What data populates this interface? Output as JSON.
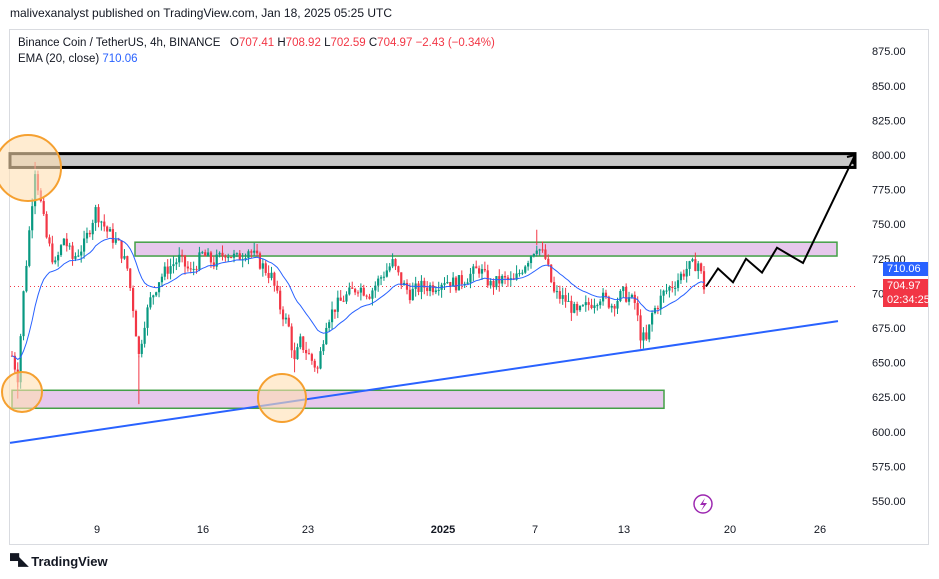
{
  "header": {
    "published_line": "malivexanalyst published on TradingView.com, Jan 18, 2025 05:25 UTC"
  },
  "legend": {
    "symbol": "Binance Coin / TetherUS, 4h, BINANCE",
    "o_label": "O",
    "o_value": "707.41",
    "h_label": "H",
    "h_value": "708.92",
    "l_label": "L",
    "l_value": "702.59",
    "c_label": "C",
    "c_value": "704.97",
    "change": "−2.43 (−0.34%)",
    "ema_label": "EMA (20, close)",
    "ema_value": "710.06"
  },
  "price_tags": {
    "ema": "710.06",
    "last": "704.97",
    "countdown": "02:34:25"
  },
  "footer": {
    "brand": "TradingView"
  },
  "colors": {
    "up": "#089981",
    "down": "#f23645",
    "ema": "#2962ff",
    "zone_fill": "#e6c8ec",
    "zone_border": "#43a047",
    "circle_fill": "#ffe0b2",
    "circle_border": "#f5a030",
    "trendline": "#2962ff",
    "projection": "#000000"
  },
  "chart_data": {
    "type": "candlestick",
    "timeframe": "4h",
    "y_axis": {
      "ticks": [
        "875.00",
        "850.00",
        "825.00",
        "800.00",
        "775.00",
        "750.00",
        "725.00",
        "700.00",
        "675.00",
        "650.00",
        "625.00",
        "600.00",
        "575.00",
        "550.00"
      ],
      "range": [
        538,
        888
      ]
    },
    "x_axis": {
      "ticks": [
        "9",
        "16",
        "23",
        "2025",
        "7",
        "13",
        "20",
        "26"
      ]
    },
    "last_price": 704.97,
    "ema_last": 710.06,
    "price_path": [
      {
        "t": 0,
        "p": 655
      },
      {
        "t": 2,
        "p": 640
      },
      {
        "t": 4,
        "p": 700
      },
      {
        "t": 6,
        "p": 745
      },
      {
        "t": 8,
        "p": 790
      },
      {
        "t": 10,
        "p": 765
      },
      {
        "t": 12,
        "p": 740
      },
      {
        "t": 15,
        "p": 720
      },
      {
        "t": 18,
        "p": 740
      },
      {
        "t": 21,
        "p": 725
      },
      {
        "t": 25,
        "p": 735
      },
      {
        "t": 29,
        "p": 760
      },
      {
        "t": 33,
        "p": 745
      },
      {
        "t": 37,
        "p": 735
      },
      {
        "t": 40,
        "p": 718
      },
      {
        "t": 42,
        "p": 690
      },
      {
        "t": 44,
        "p": 655
      },
      {
        "t": 46,
        "p": 680
      },
      {
        "t": 48,
        "p": 695
      },
      {
        "t": 51,
        "p": 710
      },
      {
        "t": 54,
        "p": 718
      },
      {
        "t": 58,
        "p": 725
      },
      {
        "t": 62,
        "p": 715
      },
      {
        "t": 66,
        "p": 728
      },
      {
        "t": 70,
        "p": 722
      },
      {
        "t": 74,
        "p": 730
      },
      {
        "t": 78,
        "p": 725
      },
      {
        "t": 82,
        "p": 732
      },
      {
        "t": 86,
        "p": 722
      },
      {
        "t": 90,
        "p": 712
      },
      {
        "t": 93,
        "p": 690
      },
      {
        "t": 96,
        "p": 675
      },
      {
        "t": 98,
        "p": 650
      },
      {
        "t": 100,
        "p": 665
      },
      {
        "t": 103,
        "p": 655
      },
      {
        "t": 106,
        "p": 645
      },
      {
        "t": 109,
        "p": 680
      },
      {
        "t": 112,
        "p": 690
      },
      {
        "t": 116,
        "p": 698
      },
      {
        "t": 120,
        "p": 705
      },
      {
        "t": 124,
        "p": 700
      },
      {
        "t": 128,
        "p": 712
      },
      {
        "t": 132,
        "p": 722
      },
      {
        "t": 135,
        "p": 708
      },
      {
        "t": 138,
        "p": 700
      },
      {
        "t": 142,
        "p": 705
      },
      {
        "t": 146,
        "p": 705
      },
      {
        "t": 150,
        "p": 710
      },
      {
        "t": 154,
        "p": 707
      },
      {
        "t": 158,
        "p": 712
      },
      {
        "t": 162,
        "p": 718
      },
      {
        "t": 166,
        "p": 706
      },
      {
        "t": 170,
        "p": 710
      },
      {
        "t": 174,
        "p": 708
      },
      {
        "t": 178,
        "p": 722
      },
      {
        "t": 182,
        "p": 735
      },
      {
        "t": 185,
        "p": 725
      },
      {
        "t": 188,
        "p": 700
      },
      {
        "t": 192,
        "p": 695
      },
      {
        "t": 196,
        "p": 685
      },
      {
        "t": 200,
        "p": 692
      },
      {
        "t": 204,
        "p": 698
      },
      {
        "t": 208,
        "p": 692
      },
      {
        "t": 212,
        "p": 700
      },
      {
        "t": 216,
        "p": 693
      },
      {
        "t": 218,
        "p": 670
      },
      {
        "t": 220,
        "p": 665
      },
      {
        "t": 222,
        "p": 685
      },
      {
        "t": 226,
        "p": 700
      },
      {
        "t": 230,
        "p": 708
      },
      {
        "t": 234,
        "p": 718
      },
      {
        "t": 238,
        "p": 722
      },
      {
        "t": 240,
        "p": 705
      }
    ],
    "annotations": {
      "resistance_zone_top": {
        "low": 791,
        "high": 801
      },
      "range_zone": {
        "low": 727,
        "high": 737
      },
      "support_zone": {
        "low": 617,
        "high": 630
      },
      "trendline": {
        "from": 592,
        "to": 680
      },
      "projection_path": [
        705,
        718,
        708,
        725,
        715,
        733,
        722,
        800
      ]
    }
  }
}
